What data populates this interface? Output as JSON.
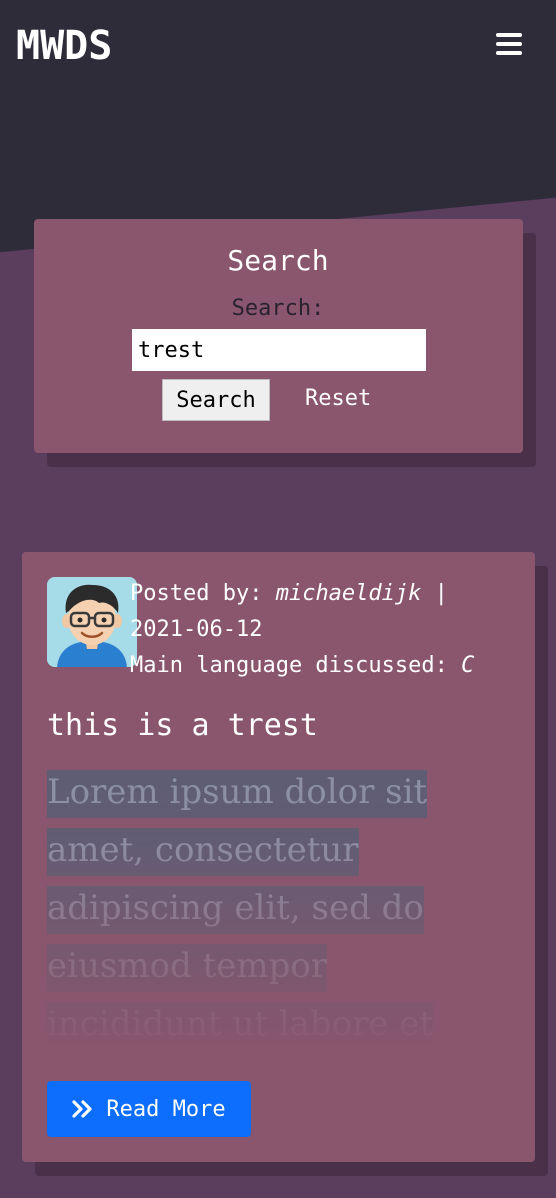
{
  "header": {
    "brand": "MWDS",
    "menu_icon": "hamburger-menu-icon"
  },
  "search": {
    "title": "Search",
    "label": "Search:",
    "input_value": "trest",
    "button_label": "Search",
    "reset_label": "Reset"
  },
  "post": {
    "avatar_icon": "user-avatar",
    "posted_by_label": "Posted by:",
    "author": "michaeldijk",
    "separator": "|",
    "date": "2021-06-12",
    "language_label": "Main language discussed:",
    "language": "C",
    "title": "this is a trest",
    "excerpt": "Lorem ipsum dolor sit amet, consectetur adipiscing elit, sed do eiusmod tempor incididunt ut labore et",
    "read_more_label": "Read More",
    "read_more_icon": "double-chevron-right-icon"
  },
  "colors": {
    "page_bg": "#5b3d5d",
    "header_bg": "#2f2c3a",
    "card_bg": "#8a566d",
    "primary_button": "#0d6efd"
  }
}
